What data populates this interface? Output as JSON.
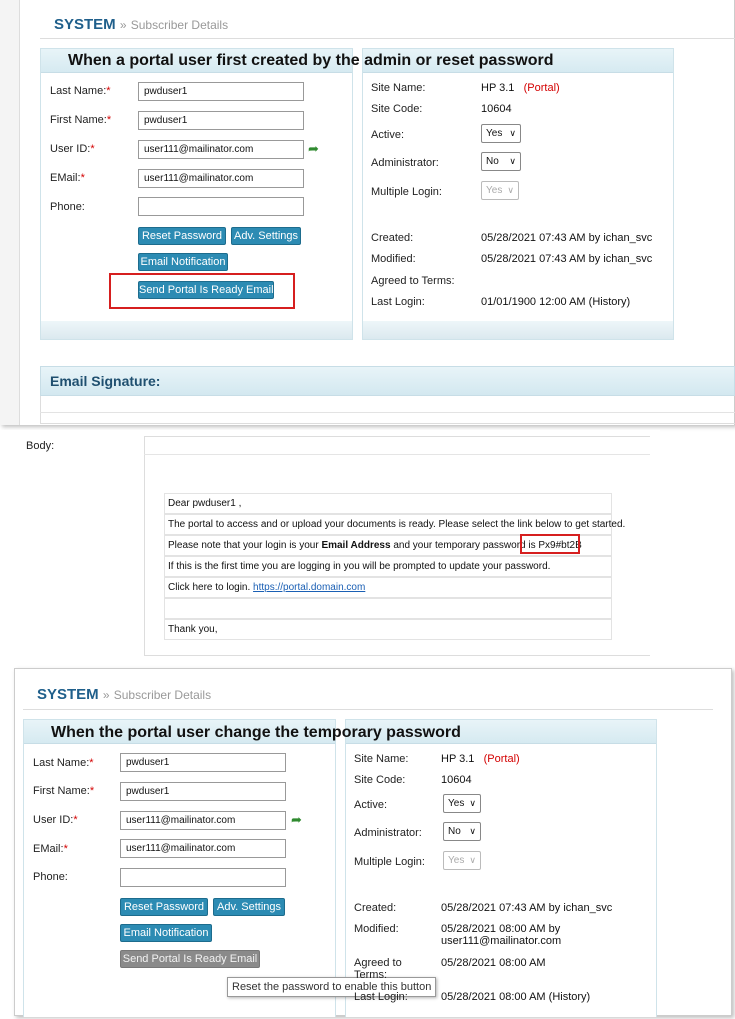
{
  "breadcrumb": {
    "system": "SYSTEM",
    "separator": "»",
    "page": "Subscriber Details"
  },
  "panel1": {
    "heading": "When a portal user first created by the admin or reset password",
    "labels": {
      "last_name": "Last Name:",
      "first_name": "First Name:",
      "user_id": "User ID:",
      "email": "EMail:",
      "phone": "Phone:",
      "required": "*"
    },
    "values": {
      "last_name": "pwduser1",
      "first_name": "pwduser1",
      "user_id": "user111@mailinator.com",
      "email": "user111@mailinator.com",
      "phone": ""
    },
    "buttons": {
      "reset_password": "Reset Password",
      "adv_settings": "Adv. Settings",
      "email_notification": "Email Notification",
      "send_portal": "Send Portal Is Ready Email"
    },
    "info": {
      "site_name_label": "Site Name:",
      "site_name": "HP 3.1",
      "portal_tag": "(Portal)",
      "site_code_label": "Site Code:",
      "site_code": "10604",
      "active_label": "Active:",
      "active": "Yes",
      "administrator_label": "Administrator:",
      "administrator": "No",
      "multiple_login_label": "Multiple Login:",
      "multiple_login": "Yes",
      "created_label": "Created:",
      "created": "05/28/2021 07:43 AM by ichan_svc",
      "modified_label": "Modified:",
      "modified": "05/28/2021 07:43 AM by ichan_svc",
      "agreed_label": "Agreed to Terms:",
      "agreed": "",
      "last_login_label": "Last Login:",
      "last_login": "01/01/1900 12:00 AM",
      "history": "(History)"
    }
  },
  "email_signature": {
    "title": "Email Signature:"
  },
  "email_body": {
    "label": "Body:",
    "greeting": "Dear pwduser1 ,",
    "line1": "The portal to access and or upload your documents is ready. Please select the link below to get started.",
    "line2_prefix": "Please note that your login is your ",
    "line2_bold": "Email Address",
    "line2_mid": " and your temporary password is ",
    "password": "Px9#bt2B",
    "line3": "If this is the first time you are logging in you will be prompted to update your password.",
    "line4_prefix": "Click here to login. ",
    "login_link": "https://portal.domain.com",
    "closing": "Thank you,"
  },
  "panel2": {
    "heading": "When the portal user change the temporary password",
    "values": {
      "last_name": "pwduser1",
      "first_name": "pwduser1",
      "user_id": "user111@mailinator.com",
      "email": "user111@mailinator.com",
      "phone": ""
    },
    "info": {
      "site_name": "HP 3.1",
      "site_code": "10604",
      "active": "Yes",
      "administrator": "No",
      "multiple_login": "Yes",
      "created": "05/28/2021 07:43 AM by ichan_svc",
      "modified_line1": "05/28/2021 08:00 AM by",
      "modified_line2": "user111@mailinator.com",
      "agreed_label_line1": "Agreed to",
      "agreed_label_line2": "Terms:",
      "agreed": "05/28/2021 08:00 AM",
      "last_login_label": "Last Login:",
      "last_login": "05/28/2021 08:00 AM",
      "history": "(History)"
    },
    "tooltip": "Reset the password to enable this button"
  }
}
